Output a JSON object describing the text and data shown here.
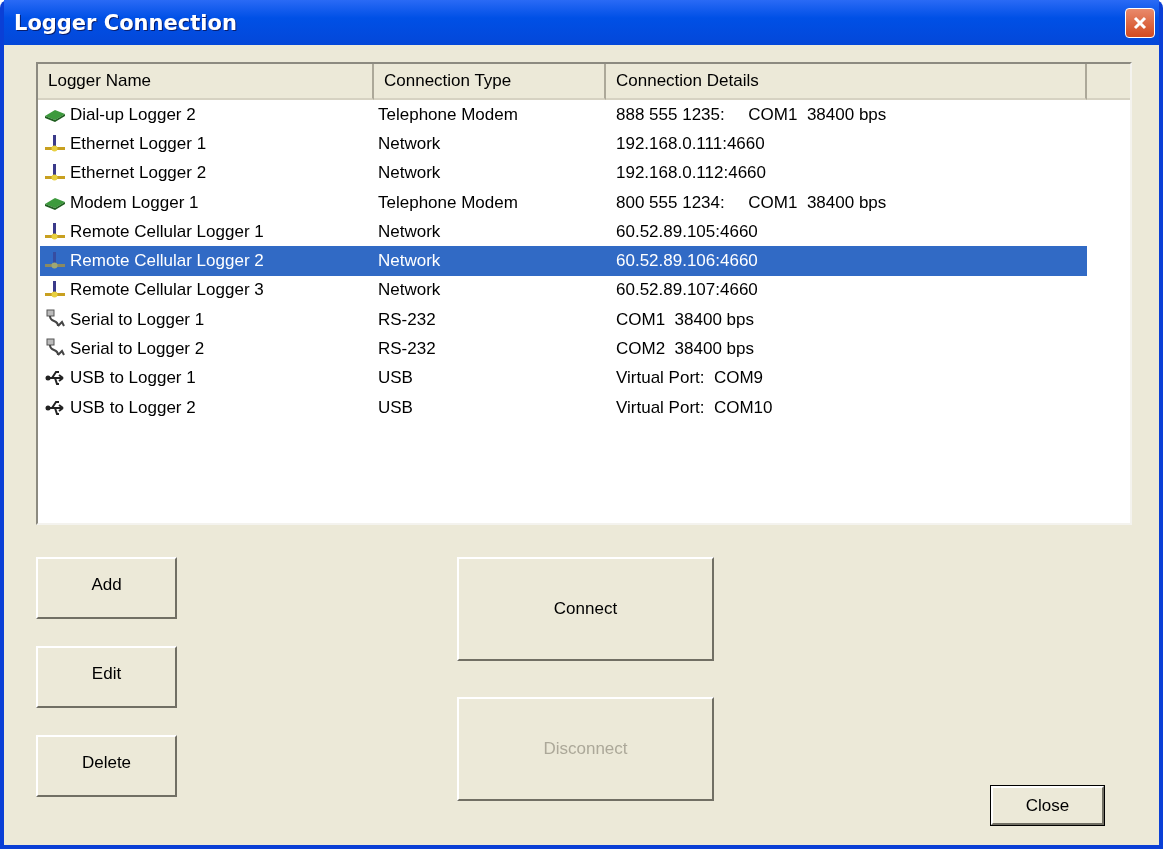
{
  "window": {
    "title": "Logger Connection"
  },
  "table": {
    "columns": [
      "Logger Name",
      "Connection Type",
      "Connection Details"
    ],
    "rows": [
      {
        "kind": "modem",
        "name": "Dial-up Logger 2",
        "type": "Telephone Modem",
        "details": "888 555 1235:     COM1  38400 bps",
        "selected": false
      },
      {
        "kind": "network",
        "name": "Ethernet Logger 1",
        "type": "Network",
        "details": "192.168.0.111:4660",
        "selected": false
      },
      {
        "kind": "network",
        "name": "Ethernet Logger 2",
        "type": "Network",
        "details": "192.168.0.112:4660",
        "selected": false
      },
      {
        "kind": "modem",
        "name": "Modem Logger 1",
        "type": "Telephone Modem",
        "details": "800 555 1234:     COM1  38400 bps",
        "selected": false
      },
      {
        "kind": "network",
        "name": "Remote Cellular Logger 1",
        "type": "Network",
        "details": "60.52.89.105:4660",
        "selected": false
      },
      {
        "kind": "network",
        "name": "Remote Cellular Logger 2",
        "type": "Network",
        "details": "60.52.89.106:4660",
        "selected": true
      },
      {
        "kind": "network",
        "name": "Remote Cellular Logger 3",
        "type": "Network",
        "details": "60.52.89.107:4660",
        "selected": false
      },
      {
        "kind": "serial",
        "name": "Serial to Logger 1",
        "type": "RS-232",
        "details": "COM1  38400 bps",
        "selected": false
      },
      {
        "kind": "serial",
        "name": "Serial to Logger 2",
        "type": "RS-232",
        "details": "COM2  38400 bps",
        "selected": false
      },
      {
        "kind": "usb",
        "name": "USB to Logger 1",
        "type": "USB",
        "details": "Virtual Port:  COM9",
        "selected": false
      },
      {
        "kind": "usb",
        "name": "USB to Logger 2",
        "type": "USB",
        "details": "Virtual Port:  COM10",
        "selected": false
      }
    ]
  },
  "buttons": {
    "add": {
      "label": "Add"
    },
    "edit": {
      "label": "Edit"
    },
    "delete": {
      "label": "Delete"
    },
    "connect": {
      "label": "Connect",
      "disabled": false
    },
    "disconnect": {
      "label": "Disconnect",
      "disabled": true
    },
    "close": {
      "label": "Close"
    }
  }
}
